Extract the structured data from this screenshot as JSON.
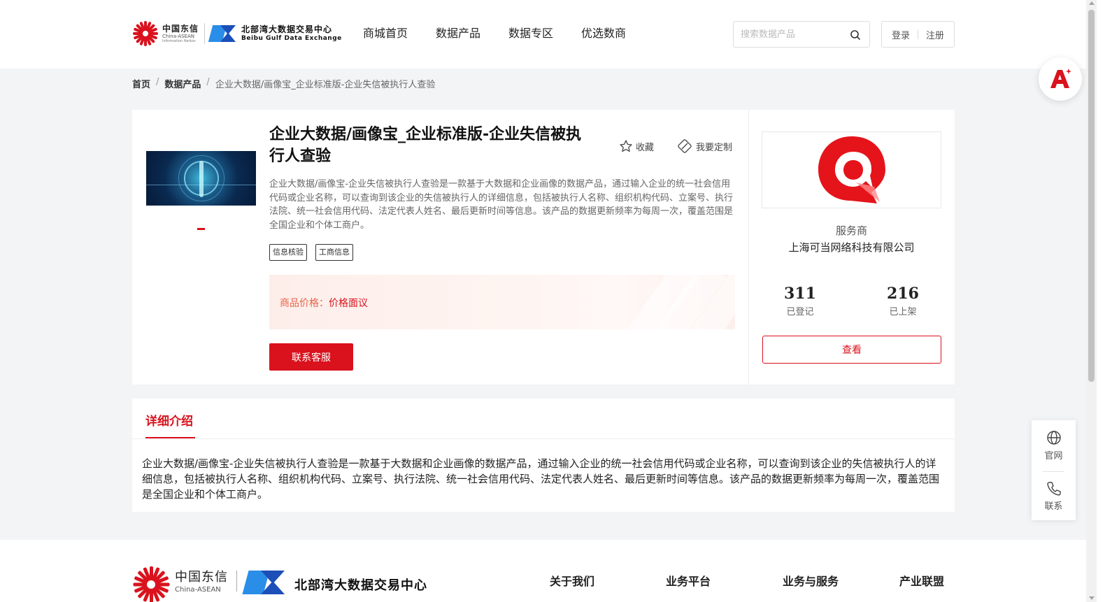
{
  "header": {
    "logo_cn": "中国东信",
    "logo_en": "China-ASEAN",
    "logo_sub": "Information Harbor",
    "partner_cn": "北部湾大数据交易中心",
    "partner_en": "Beibu Gulf Data Exchange",
    "nav": [
      "商城首页",
      "数据产品",
      "数据专区",
      "优选数商"
    ],
    "search_placeholder": "搜索数据产品",
    "login": "登录",
    "register": "注册"
  },
  "breadcrumb": {
    "home": "首页",
    "category": "数据产品",
    "sep": "/",
    "current": "企业大数据/画像宝_企业标准版-企业失信被执行人查验"
  },
  "product": {
    "title": "企业大数据/画像宝_企业标准版-企业失信被执行人查验",
    "favorite": "收藏",
    "customize": "我要定制",
    "description": "企业大数据/画像宝-企业失信被执行人查验是一款基于大数据和企业画像的数据产品，通过输入企业的统一社会信用代码或企业名称，可以查询到该企业的失信被执行人的详细信息，包括被执行人名称、组织机构代码、立案号、执行法院、统一社会信用代码、法定代表人姓名、最后更新时间等信息。该产品的数据更新频率为每周一次，覆盖范围是全国企业和个体工商户。",
    "tags": [
      "信息核验",
      "工商信息"
    ],
    "price_label": "商品价格：",
    "price_value": "价格面议",
    "contact_button": "联系客服"
  },
  "provider": {
    "label": "服务商",
    "name": "上海可当网络科技有限公司",
    "registered_count": "311",
    "registered_label": "已登记",
    "listed_count": "216",
    "listed_label": "已上架",
    "view_button": "查看"
  },
  "detail": {
    "tab": "详细介绍",
    "text": "企业大数据/画像宝-企业失信被执行人查验是一款基于大数据和企业画像的数据产品，通过输入企业的统一社会信用代码或企业名称，可以查询到该企业的失信被执行人的详细信息，包括被执行人名称、组织机构代码、立案号、执行法院、统一社会信用代码、法定代表人姓名、最后更新时间等信息。该产品的数据更新频率为每周一次，覆盖范围是全国企业和个体工商户。"
  },
  "footer": {
    "logo_cn": "中国东信",
    "logo_en": "China-ASEAN",
    "partner_cn": "北部湾大数据交易中心",
    "links": [
      "关于我们",
      "业务平台",
      "业务与服务",
      "产业联盟"
    ]
  },
  "side_tools": {
    "website": "官网",
    "contact": "联系"
  },
  "colors": {
    "brand_red": "#d9121d",
    "price_orange": "#e8634a",
    "page_bg": "#f3f4f6"
  }
}
